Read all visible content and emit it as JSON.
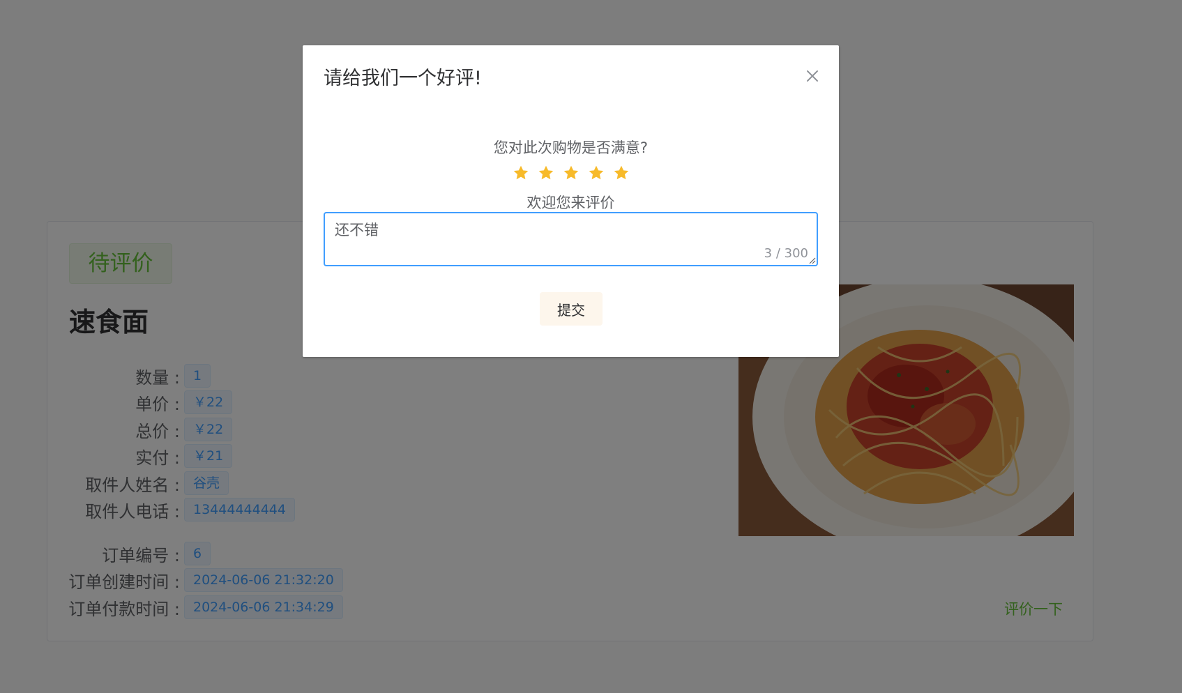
{
  "order": {
    "status_tag": "待评价",
    "product_name": "速食面",
    "fields": [
      {
        "label": "数量 :",
        "value": "1"
      },
      {
        "label": "单价 :",
        "value": "￥22"
      },
      {
        "label": "总价 :",
        "value": "￥22"
      },
      {
        "label": "实付 :",
        "value": "￥21"
      },
      {
        "label": "取件人姓名 :",
        "value": "谷壳"
      },
      {
        "label": "取件人电话 :",
        "value": "13444444444"
      }
    ],
    "meta_fields": [
      {
        "label": "订单编号 :",
        "value": "6"
      },
      {
        "label": "订单创建时间 :",
        "value": "2024-06-06 21:32:20"
      },
      {
        "label": "订单付款时间 :",
        "value": "2024-06-06 21:34:29"
      }
    ],
    "review_link": "评价一下"
  },
  "dialog": {
    "title": "请给我们一个好评!",
    "question": "您对此次购物是否满意?",
    "rating": 5,
    "rating_max": 5,
    "rate_text": "欢迎您来评价",
    "comment": "还不错",
    "char_count": "3 / 300",
    "submit_label": "提交"
  },
  "colors": {
    "star": "#f7ba2a",
    "primary": "#409eff",
    "success": "#67c23a",
    "overlay": "rgba(0,0,0,0.5)"
  },
  "icons": {
    "close": "close-icon",
    "star": "star-icon",
    "resize": "resize-handle-icon"
  }
}
